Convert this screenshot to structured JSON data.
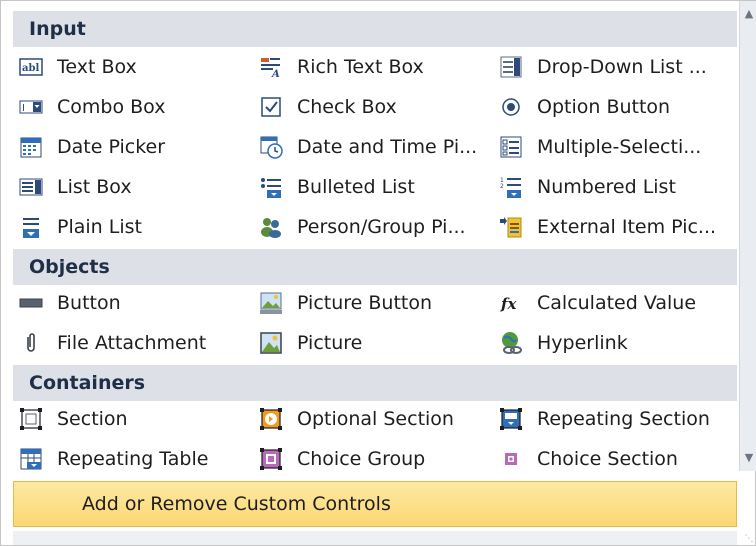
{
  "sections": {
    "input": "Input",
    "objects": "Objects",
    "containers": "Containers"
  },
  "input_items": [
    {
      "label": "Text Box",
      "icon": "text-box-icon"
    },
    {
      "label": "Rich Text Box",
      "icon": "rich-text-box-icon"
    },
    {
      "label": "Drop-Down List ...",
      "icon": "drop-down-list-icon"
    },
    {
      "label": "Combo Box",
      "icon": "combo-box-icon"
    },
    {
      "label": "Check Box",
      "icon": "check-box-icon"
    },
    {
      "label": "Option Button",
      "icon": "option-button-icon"
    },
    {
      "label": "Date Picker",
      "icon": "date-picker-icon"
    },
    {
      "label": "Date and Time Pi...",
      "icon": "date-time-picker-icon"
    },
    {
      "label": "Multiple-Selecti...",
      "icon": "multiple-selection-list-icon"
    },
    {
      "label": "List Box",
      "icon": "list-box-icon"
    },
    {
      "label": "Bulleted List",
      "icon": "bulleted-list-icon"
    },
    {
      "label": "Numbered List",
      "icon": "numbered-list-icon"
    },
    {
      "label": "Plain List",
      "icon": "plain-list-icon"
    },
    {
      "label": "Person/Group Pi...",
      "icon": "person-group-picker-icon"
    },
    {
      "label": "External Item Pic...",
      "icon": "external-item-picker-icon"
    }
  ],
  "object_items": [
    {
      "label": "Button",
      "icon": "button-icon"
    },
    {
      "label": "Picture Button",
      "icon": "picture-button-icon"
    },
    {
      "label": "Calculated Value",
      "icon": "calculated-value-icon"
    },
    {
      "label": "File Attachment",
      "icon": "file-attachment-icon"
    },
    {
      "label": "Picture",
      "icon": "picture-icon"
    },
    {
      "label": "Hyperlink",
      "icon": "hyperlink-icon"
    }
  ],
  "container_items": [
    {
      "label": "Section",
      "icon": "section-icon"
    },
    {
      "label": "Optional Section",
      "icon": "optional-section-icon"
    },
    {
      "label": "Repeating Section",
      "icon": "repeating-section-icon"
    },
    {
      "label": "Repeating Table",
      "icon": "repeating-table-icon"
    },
    {
      "label": "Choice Group",
      "icon": "choice-group-icon"
    },
    {
      "label": "Choice Section",
      "icon": "choice-section-icon"
    }
  ],
  "footer": {
    "label": "Add or Remove Custom Controls"
  },
  "colors": {
    "header_bg": "#dde1e7",
    "footer_highlight": "#fbd772",
    "accent_blue": "#2f6fba"
  }
}
